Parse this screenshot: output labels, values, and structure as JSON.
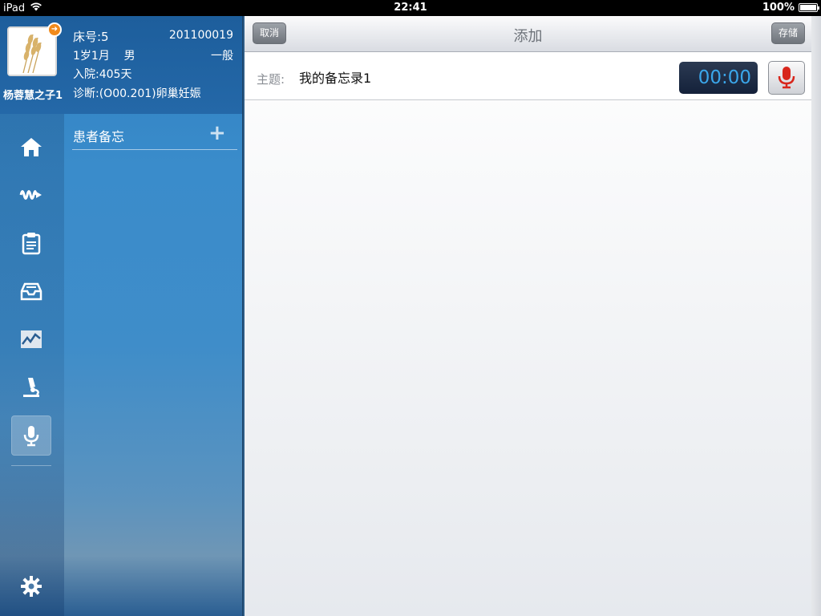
{
  "status_bar": {
    "device": "iPad",
    "time": "22:41",
    "battery_percent_label": "100%",
    "battery_level": 1.0
  },
  "patient": {
    "name": "杨蓉慧之子1",
    "bed_label": "床号:5",
    "record_id": "201100019",
    "age_sex": "1岁1月    男",
    "grade": "一般",
    "admitted": "入院:405天",
    "diagnosis": "诊断:(O00.201)卵巢妊娠",
    "badge_icon": "arrow-right-icon"
  },
  "nav_icons": [
    {
      "name": "home-icon",
      "active": false
    },
    {
      "name": "vital-signs-icon",
      "active": false
    },
    {
      "name": "clipboard-icon",
      "active": false
    },
    {
      "name": "inbox-tray-icon",
      "active": false
    },
    {
      "name": "trend-chart-icon",
      "active": false
    },
    {
      "name": "microscope-icon",
      "active": false
    },
    {
      "name": "microphone-icon",
      "active": true
    },
    {
      "name": "settings-gear-icon",
      "active": false
    }
  ],
  "section": {
    "title": "患者备忘",
    "add_symbol": "+"
  },
  "editor": {
    "title": "添加",
    "cancel_label": "取消",
    "save_label": "存储",
    "subject_label": "主题:",
    "subject_value": "我的备忘录1",
    "timer": "00:00"
  },
  "colors": {
    "sidebar_blue": "#2f7fc0",
    "timer_text": "#3aa6ea",
    "mic_red": "#d8261c",
    "badge_orange": "#f08a1c"
  }
}
